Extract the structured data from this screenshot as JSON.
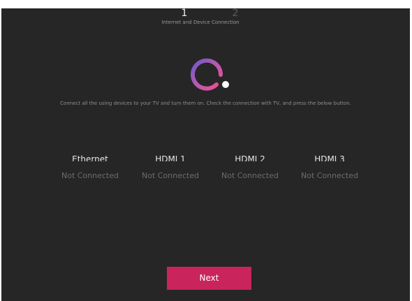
{
  "stepper": {
    "current_step": "1",
    "next_step": "2",
    "caption": "Internet and Device Connection"
  },
  "instruction": "Connect all the using devices to your TV and turn them on. Check the connection with TV, and press the below button.",
  "devices": [
    {
      "name": "Ethernet",
      "status": "Not Connected"
    },
    {
      "name": "HDMI 1",
      "status": "Not Connected"
    },
    {
      "name": "HDMI 2",
      "status": "Not Connected"
    },
    {
      "name": "HDMI 3",
      "status": "Not Connected"
    }
  ],
  "next_button": {
    "label": "Next"
  },
  "colors": {
    "background": "#262626",
    "accent": "#c9245b",
    "spinner_start": "#7a4fc0",
    "spinner_end": "#e8478e"
  },
  "icons": {
    "spinner": "loading-ring-icon"
  }
}
